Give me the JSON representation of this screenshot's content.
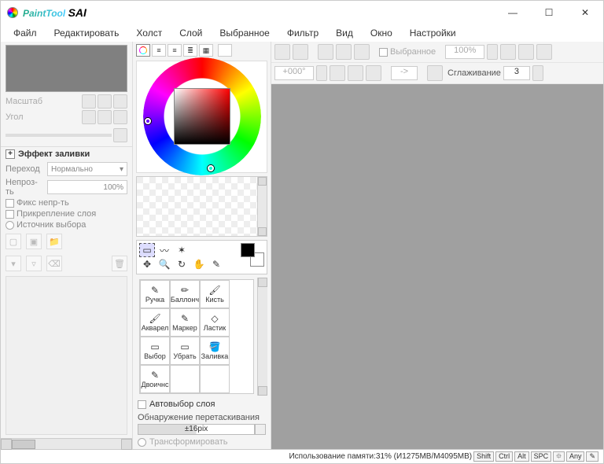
{
  "app": {
    "name_a": "PaintTool",
    "name_b": "SAI"
  },
  "window": {
    "min": "—",
    "max": "☐",
    "close": "✕"
  },
  "menu": [
    "Файл",
    "Редактировать",
    "Холст",
    "Слой",
    "Выбранное",
    "Фильтр",
    "Вид",
    "Окно",
    "Настройки"
  ],
  "nav": {
    "scale_label": "Масштаб",
    "angle_label": "Угол"
  },
  "fill_effect": {
    "title": "Эффект заливки",
    "blend_label": "Переход",
    "blend_value": "Нормально",
    "opacity_label": "Непроз-ть",
    "opacity_value": "100%",
    "fix_opacity": "Фикс непр-ть",
    "attach_layer": "Прикрепление слоя",
    "source_sel": "Источник выбора"
  },
  "color_modes": [
    "◯",
    "≡",
    "≡",
    "≣",
    "▦",
    ""
  ],
  "tools": {
    "row1": [
      "▭",
      "〰",
      "✶",
      "",
      "",
      ""
    ],
    "row2": [
      "✥",
      "🔍",
      "↻",
      "✋",
      "✎",
      ""
    ]
  },
  "brushes": [
    {
      "label": "Ручка",
      "icon": "✎"
    },
    {
      "label": "Баллонч",
      "icon": "✏"
    },
    {
      "label": "Кисть",
      "icon": "🖌"
    },
    {
      "label": "Акварел",
      "icon": "🖌"
    },
    {
      "label": "Маркер",
      "icon": "✎"
    },
    {
      "label": "Ластик",
      "icon": "◇"
    },
    {
      "label": "Выбор",
      "icon": "▭"
    },
    {
      "label": "Убрать",
      "icon": "▭"
    },
    {
      "label": "Заливка",
      "icon": "🪣"
    },
    {
      "label": "Двоичнс",
      "icon": "✎"
    }
  ],
  "auto_select": "Автовыбор слоя",
  "drag_detect": "Обнаружение перетаскивания",
  "drag_value": "±16pix",
  "transform": "Трансформировать",
  "toolbar3a": {
    "selected": "Выбранное",
    "zoom": "100%"
  },
  "toolbar3b": {
    "angle": "+000°",
    "arrow": "->",
    "smoothing_label": "Сглаживание",
    "smoothing_value": "3"
  },
  "status": {
    "mem": "Использование памяти:31% (И1275MB/M4095MB)",
    "keys": [
      "Shift",
      "Ctrl",
      "Alt",
      "SPC",
      "⯐",
      "Any",
      "✎"
    ]
  }
}
